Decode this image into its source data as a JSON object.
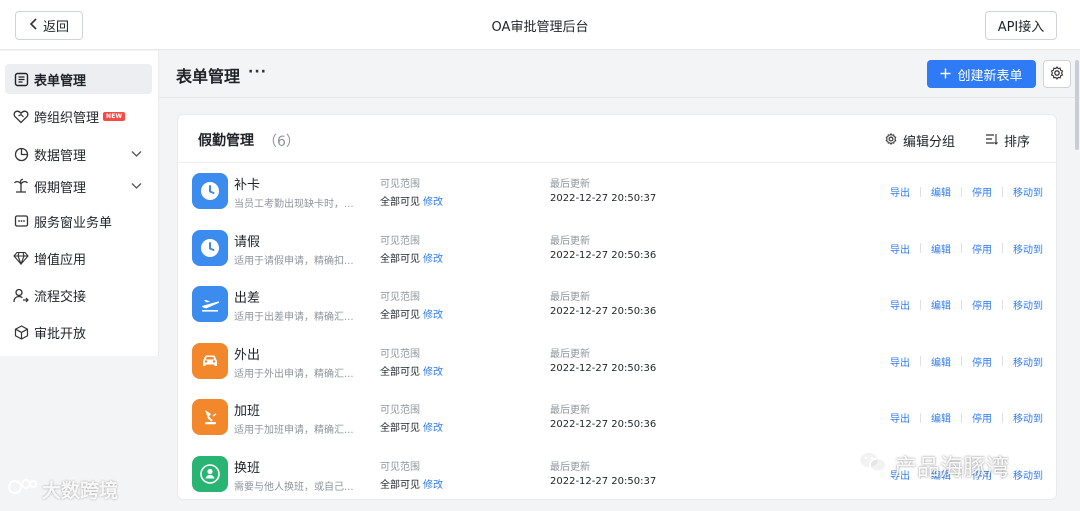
{
  "topbar": {
    "back_label": "返回",
    "title": "OA审批管理后台",
    "api_label": "API接入"
  },
  "sidebar": {
    "items": [
      {
        "label": "表单管理",
        "icon": "form-icon"
      },
      {
        "label": "跨组织管理",
        "icon": "heart-handshake-icon",
        "badge": "NEW"
      },
      {
        "label": "数据管理",
        "icon": "pie-chart-icon"
      },
      {
        "label": "假期管理",
        "icon": "palm-tree-icon"
      },
      {
        "label": "服务窗业务单",
        "icon": "message-icon"
      },
      {
        "label": "增值应用",
        "icon": "diamond-icon"
      },
      {
        "label": "流程交接",
        "icon": "user-transfer-icon"
      },
      {
        "label": "审批开放",
        "icon": "cube-icon"
      }
    ]
  },
  "header": {
    "title": "表单管理",
    "more": "···",
    "create_label": "创建新表单"
  },
  "card": {
    "title": "假勤管理",
    "count": "（6）",
    "group_edit_label": "编辑分组",
    "sort_label": "排序",
    "scope_label": "可见范围",
    "scope_value": "全部可见",
    "scope_edit": "修改",
    "updated_label": "最后更新",
    "actions": [
      "导出",
      "编辑",
      "停用",
      "移动到"
    ],
    "rows": [
      {
        "name": "补卡",
        "desc": "当员工考勤出现缺卡时，...",
        "updated": "2022-12-27 20:50:37",
        "icon": "clock-icon",
        "color": "#3c8cf0"
      },
      {
        "name": "请假",
        "desc": "适用于请假申请，精确扣...",
        "updated": "2022-12-27 20:50:36",
        "icon": "clock-icon",
        "color": "#3c8cf0"
      },
      {
        "name": "出差",
        "desc": "适用于出差申请，精确汇...",
        "updated": "2022-12-27 20:50:36",
        "icon": "airplane-icon",
        "color": "#3c8cf0"
      },
      {
        "name": "外出",
        "desc": "适用于外出申请，精确汇...",
        "updated": "2022-12-27 20:50:36",
        "icon": "car-icon",
        "color": "#f2872b"
      },
      {
        "name": "加班",
        "desc": "适用于加班申请，精确汇...",
        "updated": "2022-12-27 20:50:36",
        "icon": "desk-lamp-icon",
        "color": "#f2872b"
      },
      {
        "name": "换班",
        "desc": "需要与他人换班，或自己...",
        "updated": "2022-12-27 20:50:37",
        "icon": "user-swap-icon",
        "color": "#28b574"
      }
    ]
  },
  "watermarks": {
    "left": "大数跨境",
    "right": "产品海豚湾"
  }
}
